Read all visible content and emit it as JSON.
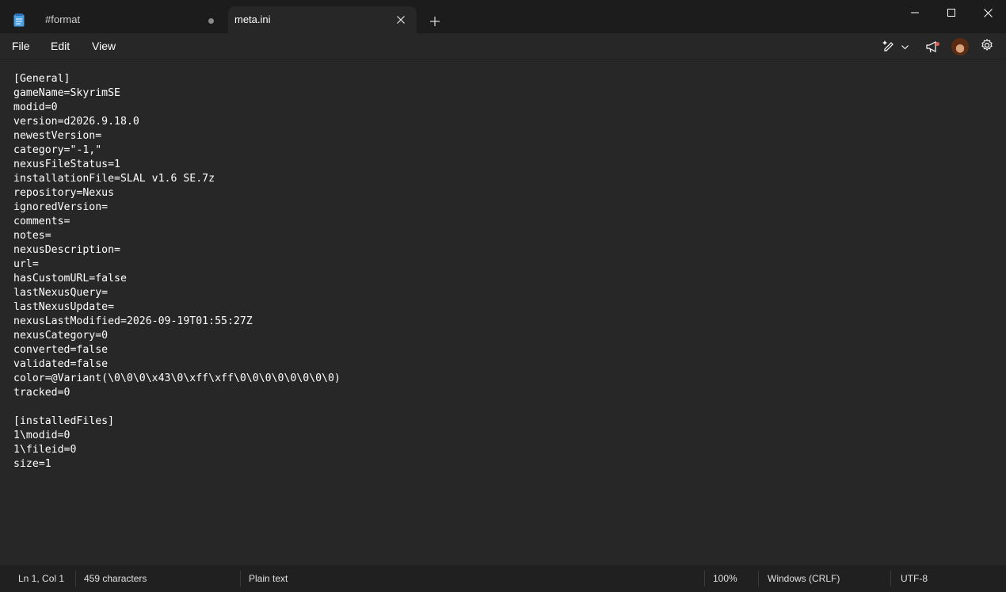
{
  "tabs": [
    {
      "label": "#format",
      "unsaved": true,
      "active": false
    },
    {
      "label": "meta.ini",
      "active": true
    }
  ],
  "icons": {
    "app": "notepad-icon",
    "close_tab": "close-icon",
    "new_tab": "plus-icon",
    "minimize": "minimize-icon",
    "maximize": "maximize-icon",
    "close_window": "close-icon",
    "copilot": "pen-sparkle-icon",
    "dropdown": "chevron-down-icon",
    "announce": "megaphone-icon",
    "avatar": "avatar",
    "settings": "gear-icon"
  },
  "menu": {
    "file": "File",
    "edit": "Edit",
    "view": "View"
  },
  "editor": {
    "content": "[General]\ngameName=SkyrimSE\nmodid=0\nversion=d2026.9.18.0\nnewestVersion=\ncategory=\"-1,\"\nnexusFileStatus=1\ninstallationFile=SLAL v1.6 SE.7z\nrepository=Nexus\nignoredVersion=\ncomments=\nnotes=\nnexusDescription=\nurl=\nhasCustomURL=false\nlastNexusQuery=\nlastNexusUpdate=\nnexusLastModified=2026-09-19T01:55:27Z\nnexusCategory=0\nconverted=false\nvalidated=false\ncolor=@Variant(\\0\\0\\0\\x43\\0\\xff\\xff\\0\\0\\0\\0\\0\\0\\0\\0)\ntracked=0\n\n[installedFiles]\n1\\modid=0\n1\\fileid=0\nsize=1"
  },
  "status": {
    "position": "Ln 1, Col 1",
    "characters": "459 characters",
    "format": "Plain text",
    "zoom": "100%",
    "line_ending": "Windows (CRLF)",
    "encoding": "UTF-8"
  },
  "colors": {
    "titlebar": "#1c1c1c",
    "editor_bg": "#272727",
    "statusbar": "#202020",
    "notification": "#e05a4f"
  }
}
